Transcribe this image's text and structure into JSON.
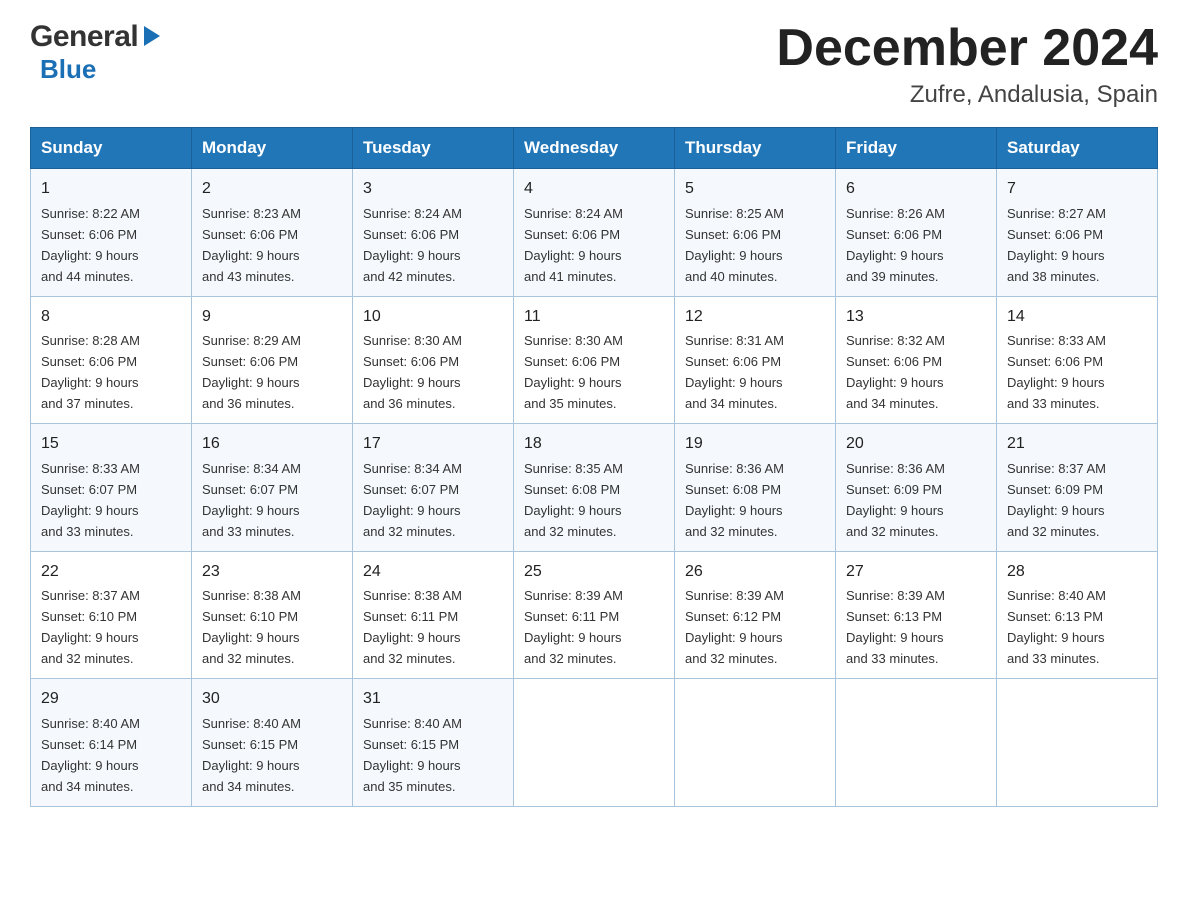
{
  "header": {
    "logo_general": "General",
    "logo_blue": "Blue",
    "month_title": "December 2024",
    "location": "Zufre, Andalusia, Spain"
  },
  "days_of_week": [
    "Sunday",
    "Monday",
    "Tuesday",
    "Wednesday",
    "Thursday",
    "Friday",
    "Saturday"
  ],
  "weeks": [
    [
      {
        "day": "1",
        "sunrise": "8:22 AM",
        "sunset": "6:06 PM",
        "daylight": "9 hours and 44 minutes."
      },
      {
        "day": "2",
        "sunrise": "8:23 AM",
        "sunset": "6:06 PM",
        "daylight": "9 hours and 43 minutes."
      },
      {
        "day": "3",
        "sunrise": "8:24 AM",
        "sunset": "6:06 PM",
        "daylight": "9 hours and 42 minutes."
      },
      {
        "day": "4",
        "sunrise": "8:24 AM",
        "sunset": "6:06 PM",
        "daylight": "9 hours and 41 minutes."
      },
      {
        "day": "5",
        "sunrise": "8:25 AM",
        "sunset": "6:06 PM",
        "daylight": "9 hours and 40 minutes."
      },
      {
        "day": "6",
        "sunrise": "8:26 AM",
        "sunset": "6:06 PM",
        "daylight": "9 hours and 39 minutes."
      },
      {
        "day": "7",
        "sunrise": "8:27 AM",
        "sunset": "6:06 PM",
        "daylight": "9 hours and 38 minutes."
      }
    ],
    [
      {
        "day": "8",
        "sunrise": "8:28 AM",
        "sunset": "6:06 PM",
        "daylight": "9 hours and 37 minutes."
      },
      {
        "day": "9",
        "sunrise": "8:29 AM",
        "sunset": "6:06 PM",
        "daylight": "9 hours and 36 minutes."
      },
      {
        "day": "10",
        "sunrise": "8:30 AM",
        "sunset": "6:06 PM",
        "daylight": "9 hours and 36 minutes."
      },
      {
        "day": "11",
        "sunrise": "8:30 AM",
        "sunset": "6:06 PM",
        "daylight": "9 hours and 35 minutes."
      },
      {
        "day": "12",
        "sunrise": "8:31 AM",
        "sunset": "6:06 PM",
        "daylight": "9 hours and 34 minutes."
      },
      {
        "day": "13",
        "sunrise": "8:32 AM",
        "sunset": "6:06 PM",
        "daylight": "9 hours and 34 minutes."
      },
      {
        "day": "14",
        "sunrise": "8:33 AM",
        "sunset": "6:06 PM",
        "daylight": "9 hours and 33 minutes."
      }
    ],
    [
      {
        "day": "15",
        "sunrise": "8:33 AM",
        "sunset": "6:07 PM",
        "daylight": "9 hours and 33 minutes."
      },
      {
        "day": "16",
        "sunrise": "8:34 AM",
        "sunset": "6:07 PM",
        "daylight": "9 hours and 33 minutes."
      },
      {
        "day": "17",
        "sunrise": "8:34 AM",
        "sunset": "6:07 PM",
        "daylight": "9 hours and 32 minutes."
      },
      {
        "day": "18",
        "sunrise": "8:35 AM",
        "sunset": "6:08 PM",
        "daylight": "9 hours and 32 minutes."
      },
      {
        "day": "19",
        "sunrise": "8:36 AM",
        "sunset": "6:08 PM",
        "daylight": "9 hours and 32 minutes."
      },
      {
        "day": "20",
        "sunrise": "8:36 AM",
        "sunset": "6:09 PM",
        "daylight": "9 hours and 32 minutes."
      },
      {
        "day": "21",
        "sunrise": "8:37 AM",
        "sunset": "6:09 PM",
        "daylight": "9 hours and 32 minutes."
      }
    ],
    [
      {
        "day": "22",
        "sunrise": "8:37 AM",
        "sunset": "6:10 PM",
        "daylight": "9 hours and 32 minutes."
      },
      {
        "day": "23",
        "sunrise": "8:38 AM",
        "sunset": "6:10 PM",
        "daylight": "9 hours and 32 minutes."
      },
      {
        "day": "24",
        "sunrise": "8:38 AM",
        "sunset": "6:11 PM",
        "daylight": "9 hours and 32 minutes."
      },
      {
        "day": "25",
        "sunrise": "8:39 AM",
        "sunset": "6:11 PM",
        "daylight": "9 hours and 32 minutes."
      },
      {
        "day": "26",
        "sunrise": "8:39 AM",
        "sunset": "6:12 PM",
        "daylight": "9 hours and 32 minutes."
      },
      {
        "day": "27",
        "sunrise": "8:39 AM",
        "sunset": "6:13 PM",
        "daylight": "9 hours and 33 minutes."
      },
      {
        "day": "28",
        "sunrise": "8:40 AM",
        "sunset": "6:13 PM",
        "daylight": "9 hours and 33 minutes."
      }
    ],
    [
      {
        "day": "29",
        "sunrise": "8:40 AM",
        "sunset": "6:14 PM",
        "daylight": "9 hours and 34 minutes."
      },
      {
        "day": "30",
        "sunrise": "8:40 AM",
        "sunset": "6:15 PM",
        "daylight": "9 hours and 34 minutes."
      },
      {
        "day": "31",
        "sunrise": "8:40 AM",
        "sunset": "6:15 PM",
        "daylight": "9 hours and 35 minutes."
      },
      null,
      null,
      null,
      null
    ]
  ],
  "labels": {
    "sunrise": "Sunrise:",
    "sunset": "Sunset:",
    "daylight": "Daylight:"
  }
}
